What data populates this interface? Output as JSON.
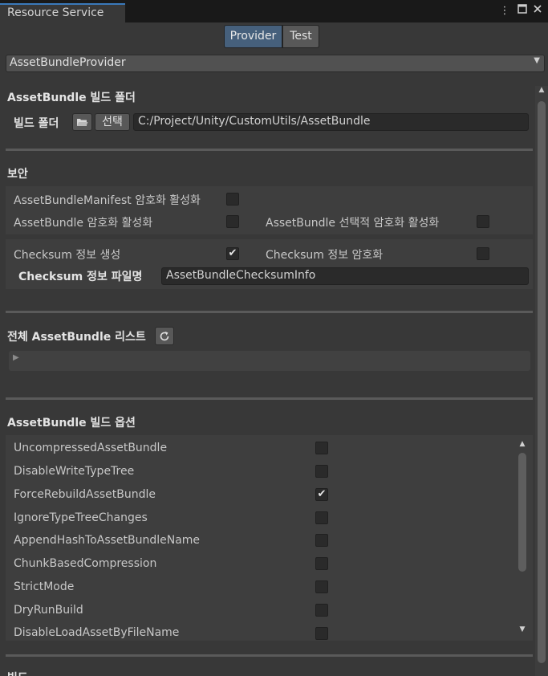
{
  "window": {
    "tab_title": "Resource Service",
    "menu_icon": "kebab-menu-icon",
    "maximize_icon": "maximize-icon",
    "close_icon": "close-icon"
  },
  "mode_tabs": [
    {
      "label": "Provider",
      "selected": true
    },
    {
      "label": "Test",
      "selected": false
    }
  ],
  "provider_dropdown": {
    "value": "AssetBundleProvider"
  },
  "build_folder": {
    "section_title": "AssetBundle 빌드 폴더",
    "label": "빌드 폴더",
    "select_button": "선택",
    "path": "C:/Project/Unity/CustomUtils/AssetBundle"
  },
  "security": {
    "section_title": "보안",
    "manifest_encrypt_label": "AssetBundleManifest 암호화 활성화",
    "manifest_encrypt_checked": false,
    "bundle_encrypt_label": "AssetBundle 암호화 활성화",
    "bundle_encrypt_checked": false,
    "selective_encrypt_label": "AssetBundle 선택적 암호화 활성화",
    "selective_encrypt_checked": false,
    "checksum_generate_label": "Checksum 정보 생성",
    "checksum_generate_checked": true,
    "checksum_encrypt_label": "Checksum 정보 암호화",
    "checksum_encrypt_checked": false,
    "checksum_filename_label": "Checksum 정보 파일명",
    "checksum_filename_value": "AssetBundleChecksumInfo"
  },
  "bundle_list": {
    "section_title": "전체 AssetBundle 리스트",
    "refresh_icon": "refresh-icon"
  },
  "build_options": {
    "section_title": "AssetBundle 빌드 옵션",
    "items": [
      {
        "label": "UncompressedAssetBundle",
        "checked": false
      },
      {
        "label": "DisableWriteTypeTree",
        "checked": false
      },
      {
        "label": "ForceRebuildAssetBundle",
        "checked": true
      },
      {
        "label": "IgnoreTypeTreeChanges",
        "checked": false
      },
      {
        "label": "AppendHashToAssetBundleName",
        "checked": false
      },
      {
        "label": "ChunkBasedCompression",
        "checked": false
      },
      {
        "label": "StrictMode",
        "checked": false
      },
      {
        "label": "DryRunBuild",
        "checked": false
      },
      {
        "label": "DisableLoadAssetByFileName",
        "checked": false
      }
    ]
  },
  "build_section": {
    "section_title": "빌드"
  },
  "colors": {
    "background": "#383838",
    "selected_tab": "#46607c",
    "tab_accent": "#3a79bb",
    "field": "#2a2a2a"
  }
}
